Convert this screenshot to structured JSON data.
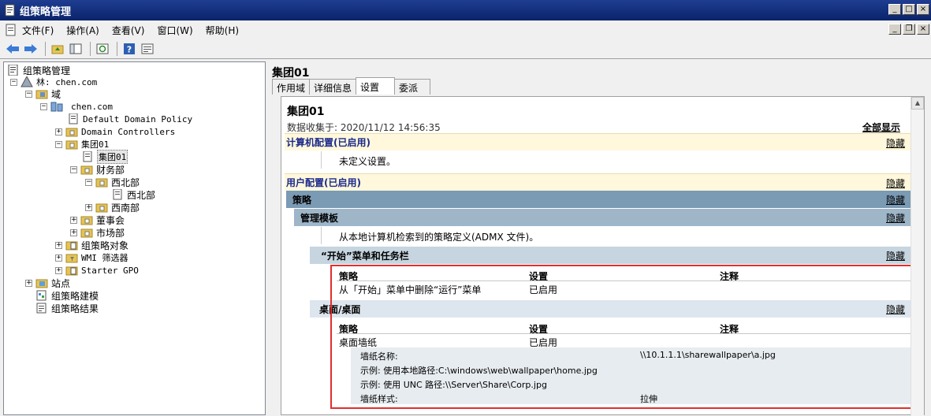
{
  "window": {
    "title": "组策略管理"
  },
  "menu": [
    "文件(F)",
    "操作(A)",
    "查看(V)",
    "窗口(W)",
    "帮助(H)"
  ],
  "window_buttons": {
    "minimize": "_",
    "restore": "□",
    "close": "×"
  },
  "mdi_buttons": {
    "minimize": "_",
    "restore": "❐",
    "close": "×"
  },
  "tree": {
    "root": "组策略管理",
    "forest": "林: chen.com",
    "domains": "域",
    "domain": "chen.com",
    "default_policy": "Default Domain Policy",
    "domain_controllers": "Domain Controllers",
    "group01": "集团01",
    "group01_gpo": "集团01",
    "finance": "财务部",
    "northwest": "西北部",
    "northwest_gpo": "西北部",
    "southwest": "西南部",
    "board": "董事会",
    "market": "市场部",
    "gpo_objects": "组策略对象",
    "wmi_filters": "WMI 筛选器",
    "starter_gpo": "Starter GPO",
    "sites": "站点",
    "modeling": "组策略建模",
    "results": "组策略结果"
  },
  "right": {
    "title": "集团01",
    "tabs": [
      "作用域",
      "详细信息",
      "设置",
      "委派"
    ],
    "active_tab": 2,
    "report": {
      "title": "集团01",
      "collected": "数据收集于: 2020/11/12 14:56:35",
      "show_all": "全部显示",
      "hide": "隐藏",
      "computer_config": "计算机配置(已启用)",
      "no_settings": "未定义设置。",
      "user_config": "用户配置(已启用)",
      "policies": "策略",
      "admin_templates": "管理模板",
      "admx_note": "从本地计算机检索到的策略定义(ADMX 文件)。",
      "start_menu": "“开始”菜单和任务栏",
      "col_policy": "策略",
      "col_setting": "设置",
      "col_comment": "注释",
      "start_policy_name": "从「开始」菜单中删除“运行”菜单",
      "start_policy_value": "已启用",
      "desktop": "桌面/桌面",
      "wallpaper_name": "桌面墙纸",
      "wallpaper_value": "已启用",
      "wp_name_label": "墙纸名称:",
      "wp_name_value": "\\\\10.1.1.1\\sharewallpaper\\a.jpg",
      "wp_example1": "示例: 使用本地路径:C:\\windows\\web\\wallpaper\\home.jpg",
      "wp_example2": "示例: 使用 UNC 路径:\\\\Server\\Share\\Corp.jpg",
      "wp_style_label": "墙纸样式:",
      "wp_style_value": "拉伸"
    }
  },
  "colors": {
    "highlight_box": "#e03030",
    "title_bar": "#0a246a"
  }
}
